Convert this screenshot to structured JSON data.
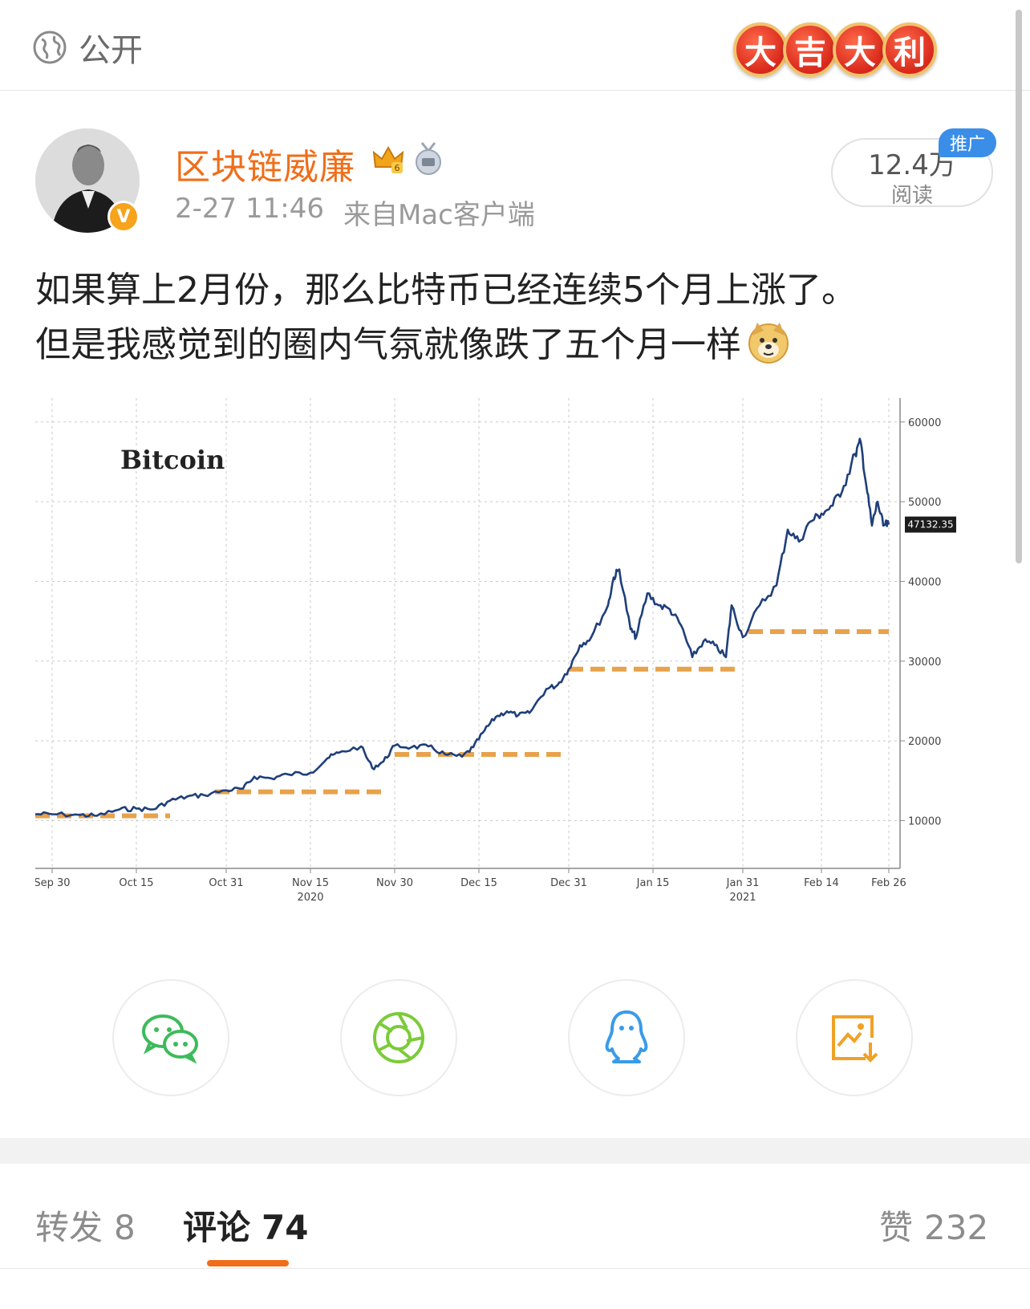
{
  "header": {
    "visibility_icon": "globe-icon",
    "visibility_label": "公开",
    "banner_chars": [
      "大",
      "吉",
      "大",
      "利"
    ]
  },
  "post": {
    "username": "区块链威廉",
    "username_color": "#f06e1a",
    "badges": [
      "vip-crown-icon",
      "medal-answer-icon"
    ],
    "verified_badge": "V",
    "time": "2-27 11:46",
    "source": "来自Mac客户端",
    "reads_count": "12.4万",
    "reads_label": "阅读",
    "promo_label": "推广",
    "text_line1": "如果算上2月份，那么比特币已经连续5个月上涨了。",
    "text_line2": "但是我感觉到的圈内气氛就像跌了五个月一样",
    "emoji": "doge-emoji"
  },
  "chart_data": {
    "type": "line",
    "title": "Bitcoin",
    "price_label": "47132.35",
    "ylim": [
      4000,
      63000
    ],
    "y_ticks": [
      "60000",
      "50000",
      "40000",
      "30000",
      "20000",
      "10000"
    ],
    "x_ticks": [
      {
        "label": "Sep 30",
        "sub": ""
      },
      {
        "label": "Oct 15",
        "sub": ""
      },
      {
        "label": "Oct 31",
        "sub": ""
      },
      {
        "label": "Nov 15",
        "sub": "2020"
      },
      {
        "label": "Nov 30",
        "sub": ""
      },
      {
        "label": "Dec 15",
        "sub": ""
      },
      {
        "label": "Dec 31",
        "sub": ""
      },
      {
        "label": "Jan 15",
        "sub": ""
      },
      {
        "label": "Jan 31",
        "sub": "2021"
      },
      {
        "label": "Feb 14",
        "sub": ""
      },
      {
        "label": "Feb 26",
        "sub": ""
      }
    ],
    "series": [
      {
        "points": [
          [
            "Sep 27",
            10800
          ],
          [
            "Sep 30",
            10800
          ],
          [
            "Oct 5",
            10700
          ],
          [
            "Oct 8",
            10600
          ],
          [
            "Oct 12",
            11400
          ],
          [
            "Oct 15",
            11500
          ],
          [
            "Oct 18",
            11400
          ],
          [
            "Oct 21",
            12500
          ],
          [
            "Oct 24",
            13000
          ],
          [
            "Oct 27",
            13200
          ],
          [
            "Oct 31",
            13800
          ],
          [
            "Nov 3",
            14000
          ],
          [
            "Nov 5",
            15500
          ],
          [
            "Nov 8",
            15300
          ],
          [
            "Nov 11",
            15800
          ],
          [
            "Nov 15",
            16000
          ],
          [
            "Nov 18",
            17800
          ],
          [
            "Nov 20",
            18500
          ],
          [
            "Nov 24",
            19300
          ],
          [
            "Nov 26",
            16600
          ],
          [
            "Nov 28",
            17400
          ],
          [
            "Nov 30",
            19400
          ],
          [
            "Dec 3",
            19200
          ],
          [
            "Dec 6",
            19300
          ],
          [
            "Dec 9",
            18300
          ],
          [
            "Dec 12",
            18000
          ],
          [
            "Dec 14",
            19200
          ],
          [
            "Dec 16",
            21300
          ],
          [
            "Dec 18",
            23000
          ],
          [
            "Dec 20",
            23700
          ],
          [
            "Dec 22",
            23200
          ],
          [
            "Dec 24",
            23500
          ],
          [
            "Dec 27",
            26500
          ],
          [
            "Dec 29",
            27000
          ],
          [
            "Dec 31",
            29000
          ],
          [
            "Jan 2",
            32000
          ],
          [
            "Jan 4",
            33000
          ],
          [
            "Jan 7",
            37000
          ],
          [
            "Jan 8",
            40500
          ],
          [
            "Jan 9",
            41500
          ],
          [
            "Jan 11",
            34000
          ],
          [
            "Jan 12",
            33000
          ],
          [
            "Jan 14",
            38500
          ],
          [
            "Jan 16",
            37000
          ],
          [
            "Jan 18",
            36500
          ],
          [
            "Jan 20",
            34500
          ],
          [
            "Jan 22",
            30500
          ],
          [
            "Jan 24",
            32500
          ],
          [
            "Jan 26",
            32000
          ],
          [
            "Jan 28",
            30500
          ],
          [
            "Jan 29",
            37000
          ],
          [
            "Jan 31",
            33000
          ],
          [
            "Feb 3",
            37000
          ],
          [
            "Feb 6",
            39500
          ],
          [
            "Feb 8",
            46500
          ],
          [
            "Feb 10",
            45000
          ],
          [
            "Feb 12",
            47500
          ],
          [
            "Feb 14",
            48500
          ],
          [
            "Feb 16",
            49500
          ],
          [
            "Feb 18",
            52000
          ],
          [
            "Feb 20",
            56000
          ],
          [
            "Feb 21",
            57500
          ],
          [
            "Feb 22",
            52000
          ],
          [
            "Feb 23",
            47000
          ],
          [
            "Feb 24",
            50000
          ],
          [
            "Feb 25",
            47000
          ],
          [
            "Feb 26",
            47132
          ]
        ]
      }
    ],
    "monthly_levels": [
      {
        "start": "Sep 27",
        "end": "Oct 21",
        "value": 10600
      },
      {
        "start": "Oct 29",
        "end": "Nov 28",
        "value": 13600
      },
      {
        "start": "Nov 30",
        "end": "Dec 30",
        "value": 18300
      },
      {
        "start": "Dec 31",
        "end": "Jan 30",
        "value": 29000
      },
      {
        "start": "Feb 1",
        "end": "Feb 26",
        "value": 33700
      }
    ],
    "line_color": "#1f3f7a",
    "level_color": "#e8a24a",
    "grid": true
  },
  "share": {
    "icons": [
      "wechat-icon",
      "moments-icon",
      "qq-icon",
      "save-image-icon"
    ],
    "colors": [
      "#3dbb5a",
      "#7ccb3a",
      "#3a9be8",
      "#f0a126"
    ]
  },
  "tabs": {
    "repost_label": "转发",
    "repost_count": "8",
    "comment_label": "评论",
    "comment_count": "74",
    "like_label": "赞",
    "like_count": "232"
  }
}
